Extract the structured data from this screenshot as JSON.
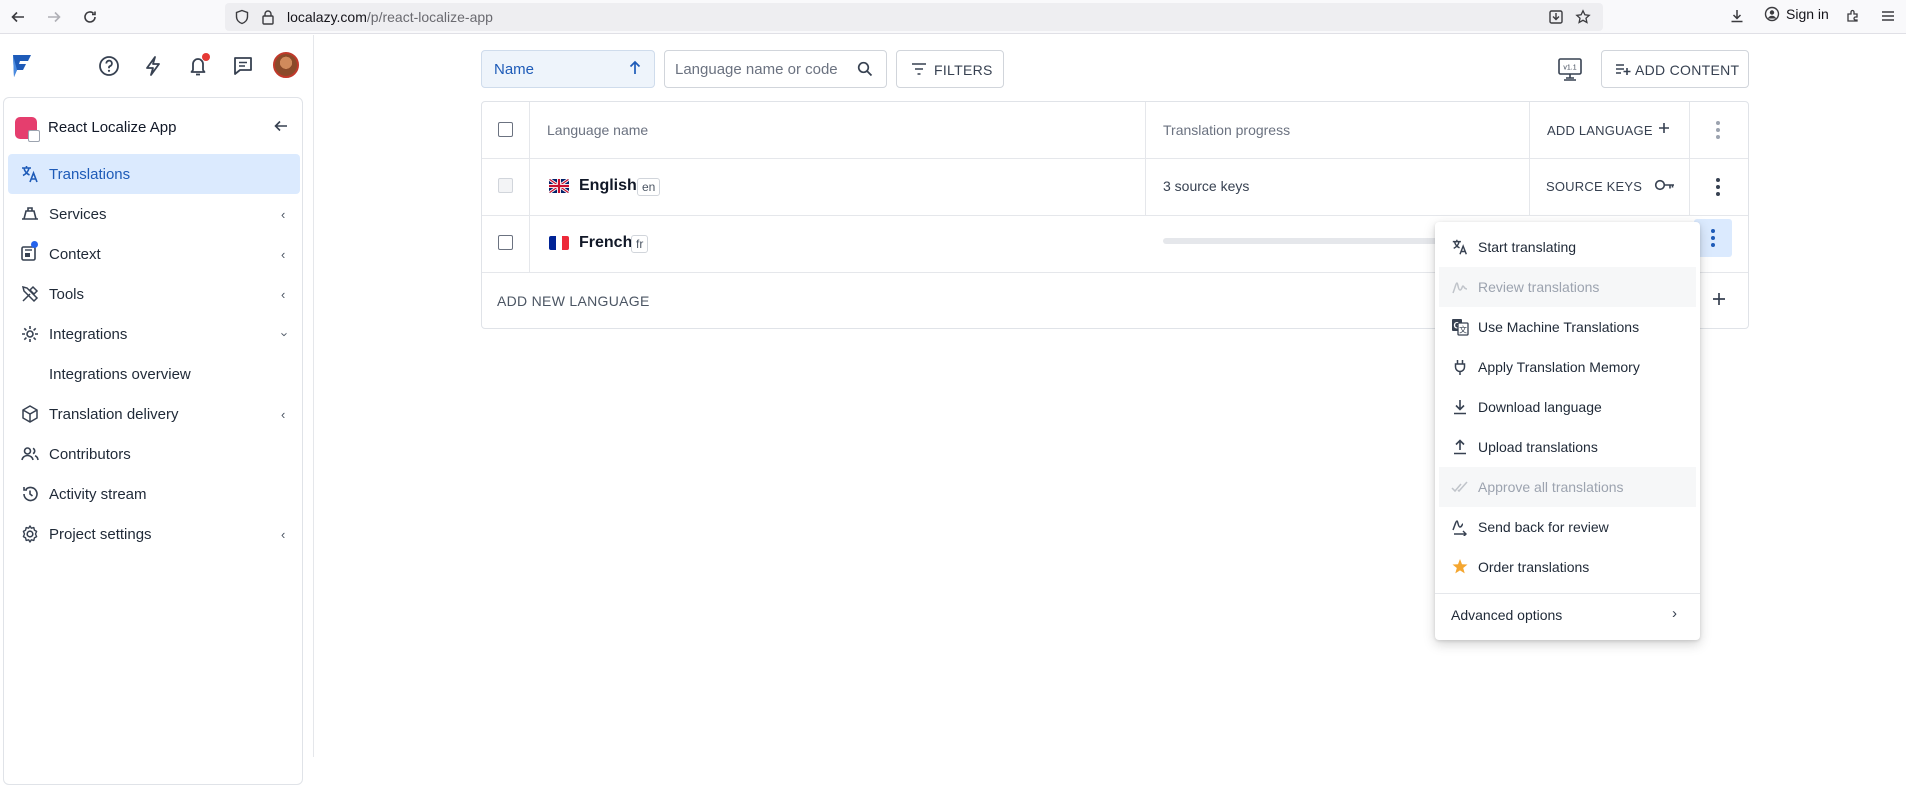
{
  "browser": {
    "url_host": "localazy.com",
    "url_path": "/p/react-localize-app",
    "sign_in_label": "Sign in"
  },
  "sidebar": {
    "project_name": "React Localize App",
    "items": [
      {
        "label": "Translations",
        "icon": "translate-icon",
        "active": true
      },
      {
        "label": "Services",
        "icon": "services-icon"
      },
      {
        "label": "Context",
        "icon": "context-icon"
      },
      {
        "label": "Tools",
        "icon": "tools-icon"
      },
      {
        "label": "Integrations",
        "icon": "integrations-icon"
      },
      {
        "label": "Integrations overview"
      },
      {
        "label": "Translation delivery",
        "icon": "delivery-icon"
      },
      {
        "label": "Contributors",
        "icon": "contributors-icon"
      },
      {
        "label": "Activity stream",
        "icon": "history-icon"
      },
      {
        "label": "Project settings",
        "icon": "settings-icon"
      }
    ]
  },
  "toolbar": {
    "sort_label": "Name",
    "search_placeholder": "Language name or code",
    "filters_label": "FILTERS",
    "version_badge": "v1.1",
    "add_content_label": "ADD CONTENT"
  },
  "table": {
    "headers": {
      "language_name": "Language name",
      "translation_progress": "Translation progress",
      "add_language": "ADD LANGUAGE"
    },
    "rows": [
      {
        "name": "English",
        "code": "en",
        "progress_text": "3 source keys",
        "action_label": "SOURCE KEYS"
      },
      {
        "name": "French",
        "code": "fr",
        "progress": 0.0
      }
    ],
    "add_new_language_label": "ADD NEW LANGUAGE"
  },
  "menu": {
    "items": [
      {
        "label": "Start translating",
        "icon": "translate-icon",
        "disabled": false
      },
      {
        "label": "Review translations",
        "icon": "review-icon",
        "disabled": true
      },
      {
        "label": "Use Machine Translations",
        "icon": "machine-translate-icon",
        "disabled": false
      },
      {
        "label": "Apply Translation Memory",
        "icon": "plug-icon",
        "disabled": false
      },
      {
        "label": "Download language",
        "icon": "download-icon",
        "disabled": false
      },
      {
        "label": "Upload translations",
        "icon": "upload-icon",
        "disabled": false
      },
      {
        "label": "Approve all translations",
        "icon": "double-check-icon",
        "disabled": true
      },
      {
        "label": "Send back for review",
        "icon": "send-back-icon",
        "disabled": false
      },
      {
        "label": "Order translations",
        "icon": "star-icon",
        "disabled": false
      }
    ],
    "advanced_label": "Advanced options"
  },
  "colors": {
    "accent": "#1e5bb8",
    "active_bg": "#dbeafe",
    "notification": "#e53935",
    "star": "#f4a630"
  }
}
